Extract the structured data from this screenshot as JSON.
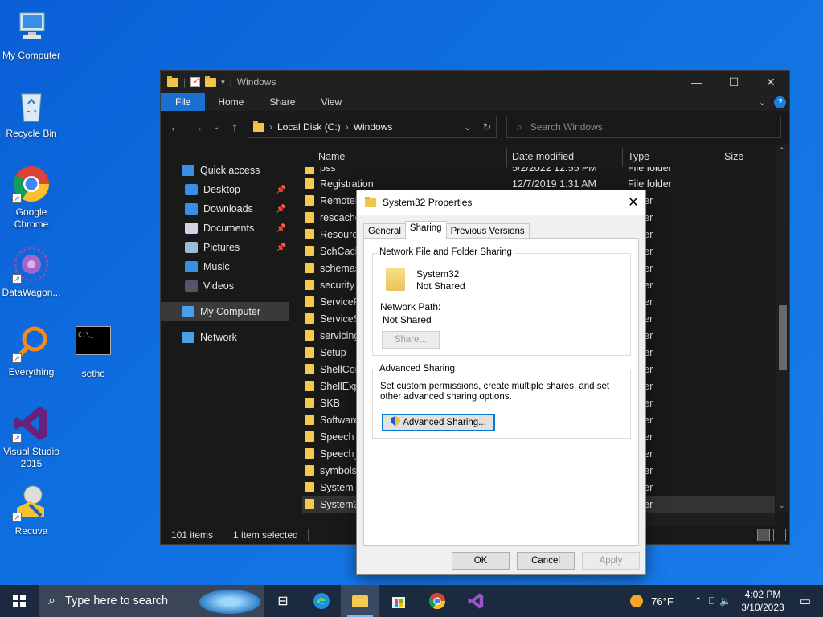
{
  "desktop": {
    "icons": [
      {
        "label": "My Computer",
        "icon": "computer-icon"
      },
      {
        "label": "Recycle Bin",
        "icon": "recycle-bin-icon"
      },
      {
        "label": "Google Chrome",
        "icon": "chrome-icon"
      },
      {
        "label": "DataWagon...",
        "icon": "datawagon-icon"
      },
      {
        "label": "Everything",
        "icon": "everything-icon"
      },
      {
        "label": "sethc",
        "icon": "console-icon",
        "console_text": "C:\\_"
      },
      {
        "label": "Visual Studio 2015",
        "icon": "visual-studio-icon"
      },
      {
        "label": "Recuva",
        "icon": "recuva-icon"
      }
    ]
  },
  "explorer": {
    "title": "Windows",
    "ribbon_tabs": [
      "File",
      "Home",
      "Share",
      "View"
    ],
    "address": {
      "root": "Local Disk (C:)",
      "current": "Windows"
    },
    "search_placeholder": "Search Windows",
    "nav": [
      {
        "label": "Quick access",
        "icon": "star-icon",
        "color": "#3b8ee6"
      },
      {
        "label": "Desktop",
        "icon": "desktop-icon",
        "color": "#3b8ee6",
        "pinned": true
      },
      {
        "label": "Downloads",
        "icon": "download-icon",
        "color": "#3b8ee6",
        "pinned": true
      },
      {
        "label": "Documents",
        "icon": "documents-icon",
        "color": "#cfd6e0",
        "pinned": true
      },
      {
        "label": "Pictures",
        "icon": "pictures-icon",
        "color": "#9fb9d8",
        "pinned": true
      },
      {
        "label": "Music",
        "icon": "music-icon",
        "color": "#3b8ee6"
      },
      {
        "label": "Videos",
        "icon": "videos-icon",
        "color": "#556"
      },
      {
        "label": "My Computer",
        "icon": "computer-icon",
        "color": "#4aa0e8",
        "selected": true
      },
      {
        "label": "Network",
        "icon": "network-icon",
        "color": "#4aa0e8"
      }
    ],
    "columns": [
      "Name",
      "Date modified",
      "Type",
      "Size"
    ],
    "rows": [
      {
        "name": "pss",
        "date": "5/2/2022 12:55 PM",
        "type": "File folder"
      },
      {
        "name": "Registration",
        "date": "12/7/2019 1:31 AM",
        "type": "File folder"
      },
      {
        "name": "RemoteP",
        "date": "",
        "type": "folder"
      },
      {
        "name": "rescache",
        "date": "",
        "type": "folder"
      },
      {
        "name": "Resource",
        "date": "",
        "type": "folder"
      },
      {
        "name": "SchCach",
        "date": "",
        "type": "folder"
      },
      {
        "name": "schemas",
        "date": "",
        "type": "folder"
      },
      {
        "name": "security",
        "date": "",
        "type": "folder"
      },
      {
        "name": "ServiceP",
        "date": "",
        "type": "folder"
      },
      {
        "name": "ServiceSt",
        "date": "",
        "type": "folder"
      },
      {
        "name": "servicing",
        "date": "",
        "type": "folder"
      },
      {
        "name": "Setup",
        "date": "",
        "type": "folder"
      },
      {
        "name": "ShellCon",
        "date": "",
        "type": "folder"
      },
      {
        "name": "ShellExpe",
        "date": "",
        "type": "folder"
      },
      {
        "name": "SKB",
        "date": "",
        "type": "folder"
      },
      {
        "name": "Software",
        "date": "",
        "type": "folder"
      },
      {
        "name": "Speech",
        "date": "",
        "type": "folder"
      },
      {
        "name": "Speech_",
        "date": "",
        "type": "folder"
      },
      {
        "name": "symbols",
        "date": "",
        "type": "folder"
      },
      {
        "name": "System",
        "date": "",
        "type": "folder"
      },
      {
        "name": "System3",
        "date": "",
        "type": "folder",
        "selected": true
      }
    ],
    "status": {
      "items": "101 items",
      "selected": "1 item selected"
    }
  },
  "dialog": {
    "title": "System32 Properties",
    "tabs": [
      "General",
      "Sharing",
      "Previous Versions"
    ],
    "active_tab": "Sharing",
    "nffs_legend": "Network File and Folder Sharing",
    "folder_name": "System32",
    "folder_status": "Not Shared",
    "network_path_label": "Network Path:",
    "network_path_value": "Not Shared",
    "share_button": "Share...",
    "adv_legend": "Advanced Sharing",
    "adv_desc": "Set custom permissions, create multiple shares, and set other advanced sharing options.",
    "adv_button": "Advanced Sharing...",
    "ok": "OK",
    "cancel": "Cancel",
    "apply": "Apply"
  },
  "taskbar": {
    "search_placeholder": "Type here to search",
    "weather": "76°F",
    "time": "4:02 PM",
    "date": "3/10/2023"
  }
}
